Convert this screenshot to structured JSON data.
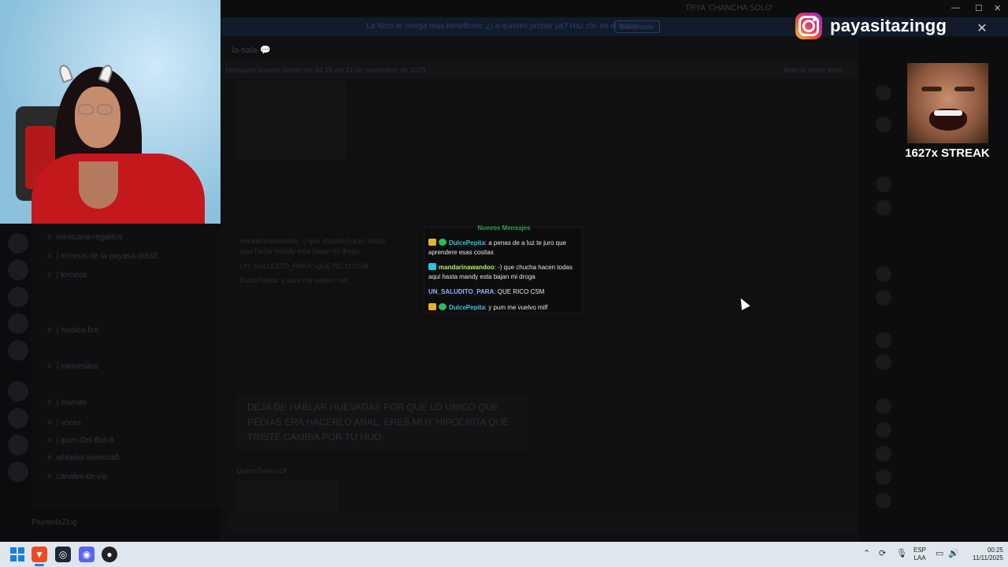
{
  "discord": {
    "window_title": "TRYA 'CHANCHA SOLO' ",
    "banner_text": "La Nitro te otorga más beneficios. ¿Lo quieres probar ya? Haz clic en el botón.",
    "banner_button": "Suscríbete",
    "channel_header": "la-sala-💬",
    "pinned_text": "Mensajes nuevos desde las 24:18 del 11 de noviembre de 2025",
    "pinned_right": "Marcar como leído",
    "channels": [
      "mexicana-regalitos",
      "| torneos-de-la-payasa-dota2",
      "| torneos",
      "| musica bot",
      "| memesitos",
      "| mamas",
      "| voces",
      "| lpum-Del-Bot-B",
      "whitelist-minecraft",
      "canales-de-vip"
    ],
    "user_name": "PayasitaZing",
    "dim_messages": [
      "mandarinawandoo: -) que chucha hacen todas aqui hasta mandy esta bajan mi droga",
      "UN_SALUDITO_PARA: QUE RICO CSM",
      "DulcePepita: y pum me vuelvo milf"
    ],
    "quote": "DEJA DE HABLAR HUEVADAS POR QUE LO UNICO QUE PEDIAS ERA HACERLO ANAL, ERES MUY HIPOCRITA QUE TRISTE CAMBIA POR TU HIJO",
    "quote_author": "QuesoTeamo18"
  },
  "chat": {
    "title": "Nuevos Mensajes",
    "messages": [
      {
        "user": "DulcePepita",
        "user_color": "#3fc3d6",
        "text": ": a penas de a luz te juro que aprendere esas cositas",
        "badges": [
          "crown",
          "check"
        ]
      },
      {
        "user": "mandarinawandoo",
        "user_color": "#b6f07a",
        "text": ": -) que chucha hacen todas aqui hasta mandy esta bajan mi droga",
        "badges": [
          "cyan"
        ]
      },
      {
        "user": "UN_SALUDITO_PARA",
        "user_color": "#8fb0ff",
        "text": ": QUE RICO CSM",
        "badges": []
      },
      {
        "user": "DulcePepita",
        "user_color": "#3fc3d6",
        "text": ": y pum me vuelvo milf",
        "badges": [
          "crown",
          "check"
        ]
      }
    ]
  },
  "instagram": {
    "handle": "payasitazingg",
    "icon": "instagram-icon"
  },
  "streak": {
    "label": "1627x STREAK"
  },
  "taskbar": {
    "apps": [
      "windows-start",
      "brave",
      "steam",
      "discord",
      "obs"
    ],
    "lang_line1": "ESP",
    "lang_line2": "LAA",
    "time": "00:25",
    "date": "11/11/2025"
  }
}
